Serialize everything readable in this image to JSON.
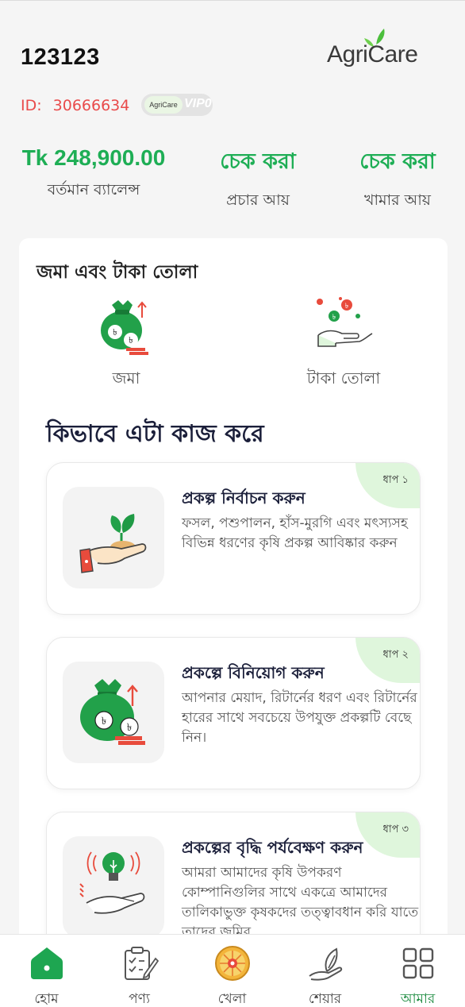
{
  "header": {
    "username": "123123",
    "brand": "AgriCare",
    "id_label": "ID:",
    "id_value": "30666634",
    "vip_logo": "AgriCare",
    "vip_level": "VIP0"
  },
  "stats": [
    {
      "value": "Tk 248,900.00",
      "label": "বর্তমান ব্যালেন্স"
    },
    {
      "value": "চেক করা",
      "label": "প্রচার আয়"
    },
    {
      "value": "চেক করা",
      "label": "খামার আয়"
    }
  ],
  "wallet": {
    "title": "জমা এবং টাকা তোলা",
    "deposit_label": "জমা",
    "withdraw_label": "টাকা তোলা"
  },
  "how": {
    "title": "কিভাবে এটা কাজ করে",
    "steps": [
      {
        "tag": "ধাপ ১",
        "title": "প্রকল্প নির্বাচন করুন",
        "desc": "ফসল, পশুপালন, হাঁস-মুরগি এবং মৎস্যসহ বিভিন্ন ধরণের কৃষি প্রকল্প আবিষ্কার করুন",
        "icon": "seedling-hand-icon"
      },
      {
        "tag": "ধাপ ২",
        "title": "প্রকল্পে বিনিয়োগ করুন",
        "desc": "আপনার মেয়াদ, রিটার্নের ধরণ এবং রিটার্নের হারের সাথে সবচেয়ে উপযুক্ত প্রকল্পটি বেছে নিন।",
        "icon": "money-bag-icon"
      },
      {
        "tag": "ধাপ ৩",
        "title": "প্রকল্পের বৃদ্ধি পর্যবেক্ষণ করুন",
        "desc": "আমরা আমাদের কৃষি উপকরণ কোম্পানিগুলির সাথে একত্রে আমাদের তালিকাভুক্ত কৃষকদের তত্ত্বাবধান করি যাতে তাদের জমির",
        "icon": "lightbulb-hand-icon"
      }
    ]
  },
  "nav": [
    {
      "label": "হোম",
      "icon": "home-icon"
    },
    {
      "label": "পণ্য",
      "icon": "clipboard-pen-icon"
    },
    {
      "label": "খেলা",
      "icon": "wheel-icon"
    },
    {
      "label": "শেয়ার",
      "icon": "share-hand-icon"
    },
    {
      "label": "আমার",
      "icon": "grid-icon",
      "active": true
    }
  ],
  "colors": {
    "accent": "#1eae55",
    "id_red": "#e94b4b",
    "step_corner": "#dff6dc",
    "nav_active": "#1a8a3e"
  }
}
